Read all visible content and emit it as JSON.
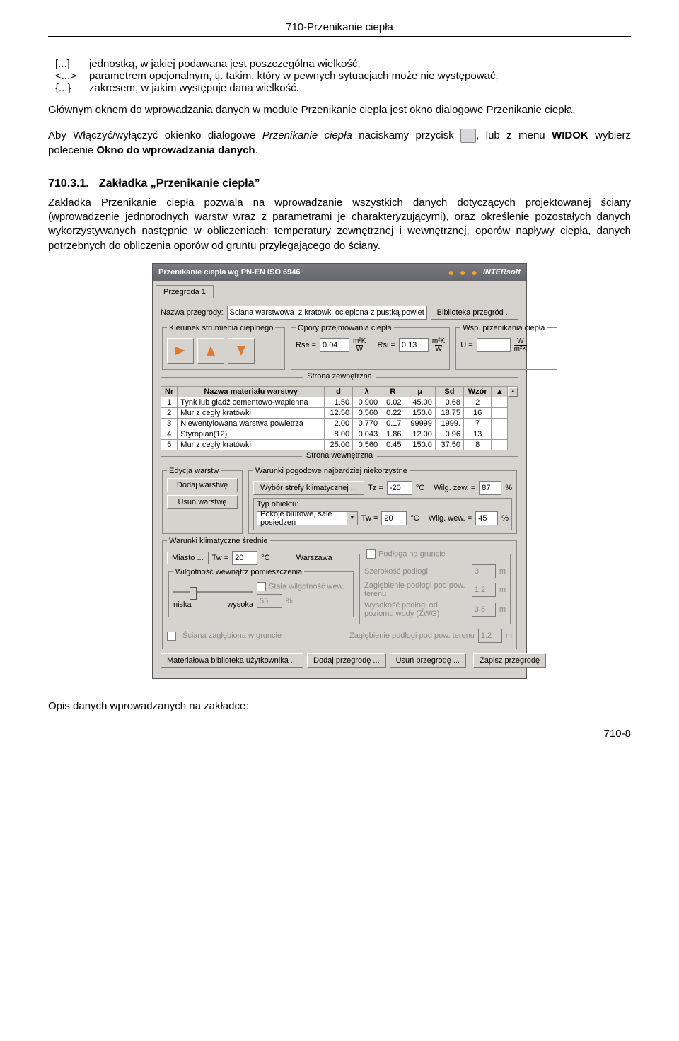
{
  "header": {
    "title": "710-Przenikanie ciepła"
  },
  "intro": {
    "def1_sym": "[...]",
    "def1_txt": "jednostką, w jakiej podawana jest poszczególna wielkość,",
    "def2_sym": "<...>",
    "def2_txt": "parametrem opcjonalnym, tj. takim, który w pewnych sytuacjach może nie występować,",
    "def3_sym": "{...}",
    "def3_txt": "zakresem, w jakim występuje dana wielkość.",
    "p1": "Głównym oknem do wprowadzania danych w module Przenikanie ciepła jest okno dialogowe Przenikanie ciepła.",
    "p2a": "Aby Włączyć/wyłączyć okienko dialogowe ",
    "p2b": "Przenikanie ciepła",
    "p2c": " naciskamy przycisk",
    "p2d": ", lub z menu ",
    "p2e": "WIDOK",
    "p2f": " wybierz polecenie ",
    "p2g": "Okno do wprowadzania danych",
    "p2h": "."
  },
  "section": {
    "num": "710.3.1.",
    "title": "Zakładka „Przenikanie ciepła”",
    "body": "Zakładka Przenikanie ciepła pozwala na wprowadzanie wszystkich danych dotyczących projektowanej ściany (wprowadzenie jednorodnych warstw wraz z parametrami je charakteryzującymi), oraz określenie pozostałych danych wykorzystywanych następnie w obliczeniach: temperatury zewnętrznej i wewnętrznej, oporów napływy ciepła, danych potrzebnych do obliczenia oporów od gruntu przylegającego do ściany."
  },
  "dlg": {
    "title": "Przenikanie ciepła wg PN-EN ISO 6946",
    "brand": "INTERsoft",
    "tab": "Przegroda 1",
    "nazwa_lbl": "Nazwa przegrody:",
    "nazwa_val": "Ściana warstwowa  z kratówki ocieplona z pustką powietrzną",
    "btn_bibl": "Biblioteka przegród ...",
    "fs_kier": "Kierunek strumienia cieplnego",
    "fs_opory": "Opory przejmowania ciepła",
    "rse_lbl": "Rse =",
    "rse_val": "0.04",
    "rse_unit_top": "m²K",
    "rse_unit_bot": "W",
    "rsi_lbl": "Rsi =",
    "rsi_val": "0.13",
    "fs_wsp": "Wsp. przenikania ciepła",
    "u_lbl": "U =",
    "u_val": "",
    "u_unit_top": "W",
    "u_unit_bot": "m²K",
    "sep_out": "Strona zewnętrzna",
    "thead": [
      "Nr",
      "Nazwa materiału warstwy",
      "d",
      "λ",
      "R",
      "μ",
      "Sd",
      "Wzór"
    ],
    "rows": [
      {
        "nr": "1",
        "name": "Tynk lub gładź cementowo-wapienna",
        "d": "1.50",
        "l": "0.900",
        "r": "0.02",
        "mu": "45.00",
        "sd": "0.68",
        "wz": "2"
      },
      {
        "nr": "2",
        "name": "Mur z cegły kratówki",
        "d": "12.50",
        "l": "0.560",
        "r": "0.22",
        "mu": "150.0",
        "sd": "18.75",
        "wz": "16"
      },
      {
        "nr": "3",
        "name": "Niewentylowana warstwa powietrza",
        "d": "2.00",
        "l": "0.770",
        "r": "0.17",
        "mu": "99999",
        "sd": "1999.",
        "wz": "7"
      },
      {
        "nr": "4",
        "name": "Styropian(12)",
        "d": "8.00",
        "l": "0.043",
        "r": "1.86",
        "mu": "12.00",
        "sd": "0.96",
        "wz": "13"
      },
      {
        "nr": "5",
        "name": "Mur z cegły kratówki",
        "d": "25.00",
        "l": "0.560",
        "r": "0.45",
        "mu": "150.0",
        "sd": "37.50",
        "wz": "8"
      }
    ],
    "sep_in": "Strona wewnętrzna",
    "fs_edit": "Edycja warstw",
    "btn_add": "Dodaj warstwę",
    "btn_del": "Usuń warstwę",
    "fs_pogoda": "Warunki pogodowe najbardziej niekorzystne",
    "btn_strefa": "Wybór strefy klimatycznej ...",
    "tz_lbl": "Tz =",
    "tz_val": "-20",
    "tz_unit": "°C",
    "wilg_zew_lbl": "Wilg. zew. =",
    "wilg_zew_val": "87",
    "pct": "%",
    "typ_lbl": "Typ obiektu:",
    "typ_val": "Pokoje biurowe, sale posiedzeń",
    "tw_lbl": "Tw =",
    "tw_val": "20",
    "wilg_wew_lbl": "Wilg. wew. =",
    "wilg_wew_val": "45",
    "fs_klim": "Warunki klimatyczne średnie",
    "btn_miasto": "Miasto ...",
    "twavg_lbl": "Tw =",
    "twavg_val": "20",
    "twavg_unit": "°C",
    "miasto": "Warszawa",
    "fs_wilgwew": "Wilgotność wewnątrz pomieszczenia",
    "chk_stala": "Stała wilgotność wew.",
    "stala_val": "55",
    "sl_low": "niska",
    "sl_high": "wysoka",
    "fs_podloga": "Podłoga na gruncie",
    "szer_lbl": "Szerokość podłogi",
    "szer_val": "3",
    "m": "m",
    "zag_t_lbl": "Zagłębienie podłogi pod pow. terenu",
    "zag_t_val": "1.2",
    "wys_lbl": "Wysokość podłogi od poziomu wody (ZWG)",
    "wys_val": "3.5",
    "chk_sciana": "Ściana zagłębiona w gruncie",
    "zag2_lbl": "Zagłębienie podłogi pod pow. terenu",
    "zag2_val": "1.2",
    "btn_matlib": "Materiałowa biblioteka użytkownika ...",
    "btn_addp": "Dodaj przegrodę ...",
    "btn_delp": "Usuń przegrodę ...",
    "btn_save": "Zapisz przegrodę"
  },
  "final": "Opis danych wprowadzanych na zakładce:",
  "footer": "710-8"
}
